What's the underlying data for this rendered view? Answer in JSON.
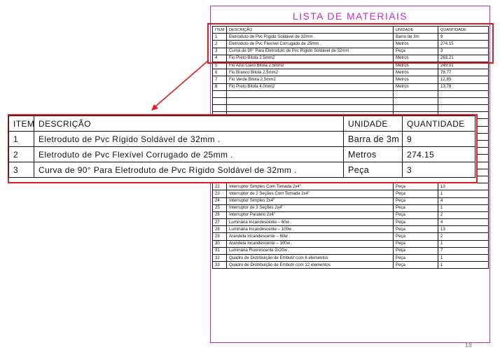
{
  "document": {
    "title": "LISTA DE MATERIAIS",
    "page_number": "18",
    "headers": {
      "item": "ITEM",
      "description": "DESCRIÇÃO",
      "unit": "UNIDADE",
      "quantity": "QUANTIDADE"
    },
    "rows": [
      {
        "item": "1",
        "description": "Eletroduto de Pvc Rígido Soldável de 32mm .",
        "unit": "Barra de 3m",
        "quantity": "9"
      },
      {
        "item": "2",
        "description": "Eletroduto de Pvc Flexível Corrugado de 25mm .",
        "unit": "Metros",
        "quantity": "274.15"
      },
      {
        "item": "3",
        "description": "Curva de 90° Para Eletroduto de Pvc Rígido Soldável de 32mm .",
        "unit": "Peça",
        "quantity": "3"
      },
      {
        "item": "4",
        "description": "Fio Preto Bitola 2.5mm2",
        "unit": "Metros",
        "quantity": "263.21"
      },
      {
        "item": "5",
        "description": "Fio Azul Claro Bitola 2.5mm2",
        "unit": "Metros",
        "quantity": "249.01"
      },
      {
        "item": "6",
        "description": "Fio Branco Bitola 2.5mm2",
        "unit": "Metros",
        "quantity": "78.77"
      },
      {
        "item": "7",
        "description": "Fio Verde Bitola 2.5mm2",
        "unit": "Metros",
        "quantity": "12.85"
      },
      {
        "item": "8",
        "description": "Fio Preto Bitola 4.0mm2",
        "unit": "Metros",
        "quantity": "13.78"
      },
      {
        "item": "",
        "description": "",
        "unit": "",
        "quantity": ""
      },
      {
        "item": "",
        "description": "",
        "unit": "",
        "quantity": ""
      },
      {
        "item": "",
        "description": "",
        "unit": "",
        "quantity": ""
      },
      {
        "item": "",
        "description": "",
        "unit": "",
        "quantity": ""
      },
      {
        "item": "",
        "description": "",
        "unit": "",
        "quantity": ""
      },
      {
        "item": "",
        "description": "",
        "unit": "",
        "quantity": ""
      },
      {
        "item": "",
        "description": "",
        "unit": "",
        "quantity": ""
      },
      {
        "item": "",
        "description": "",
        "unit": "",
        "quantity": ""
      },
      {
        "item": "17",
        "description": "Disjuntor Unipolar de 10A",
        "unit": "Peça",
        "quantity": "4"
      },
      {
        "item": "18",
        "description": "Disjuntor Unipolar de 15A",
        "unit": "Peça",
        "quantity": "3"
      },
      {
        "item": "19",
        "description": "Disjuntor Unipolar de 30A",
        "unit": "Peça",
        "quantity": "3"
      },
      {
        "item": "20",
        "description": "Tomada 2P 2x4\"",
        "unit": "Peça",
        "quantity": "46"
      },
      {
        "item": "21",
        "description": "Tomada 2P+T 2x4\"",
        "unit": "Peça",
        "quantity": "4"
      },
      {
        "item": "22",
        "description": "Interruptor Simples Com Tomada 2x4\"",
        "unit": "Peça",
        "quantity": "13"
      },
      {
        "item": "23",
        "description": "Interruptor de 2 Seções Com Tomada 2x4\"",
        "unit": "Peça",
        "quantity": "1"
      },
      {
        "item": "24",
        "description": "Interruptor Simples 2x4\"",
        "unit": "Peça",
        "quantity": "4"
      },
      {
        "item": "25",
        "description": "Interruptor de 3 Seções 2x4\"",
        "unit": "Peça",
        "quantity": "1"
      },
      {
        "item": "26",
        "description": "Interruptor Paralelo 2x4\"",
        "unit": "Peça",
        "quantity": "2"
      },
      {
        "item": "27",
        "description": "Luminária Incandescente – 60w .",
        "unit": "Peça",
        "quantity": "4"
      },
      {
        "item": "28",
        "description": "Luminária Incandescente – 100w .",
        "unit": "Peça",
        "quantity": "13"
      },
      {
        "item": "29",
        "description": "Arandela Incandescente – 60w .",
        "unit": "Peça",
        "quantity": "2"
      },
      {
        "item": "30",
        "description": "Arandela Incandescente – 100w .",
        "unit": "Peça",
        "quantity": "1"
      },
      {
        "item": "31",
        "description": "Luminária Fluorescente 2x20w .",
        "unit": "Peça",
        "quantity": "7"
      },
      {
        "item": "32",
        "description": "Quadro de Distribuição de Embutir com 6 elementos",
        "unit": "Peça",
        "quantity": "1"
      },
      {
        "item": "33",
        "description": "Quadro de Distribuição de Embutir com 12 elementos",
        "unit": "Peça",
        "quantity": "1"
      }
    ]
  },
  "zoom": {
    "headers": {
      "item": "ITEM",
      "description": "DESCRIÇÃO",
      "unit": "UNIDADE",
      "quantity": "QUANTIDADE"
    },
    "rows": [
      {
        "item": "1",
        "description": "Eletroduto de Pvc Rígido Soldável de 32mm .",
        "unit": "Barra de 3m",
        "quantity": "9"
      },
      {
        "item": "2",
        "description": "Eletroduto de Pvc Flexível Corrugado de 25mm .",
        "unit": "Metros",
        "quantity": "274.15"
      },
      {
        "item": "3",
        "description": "Curva de 90° Para Eletroduto de Pvc Rígido Soldável de 32mm .",
        "unit": "Peça",
        "quantity": "3"
      }
    ]
  },
  "colors": {
    "frame": "#c42bc4",
    "highlight": "#e5191f"
  }
}
